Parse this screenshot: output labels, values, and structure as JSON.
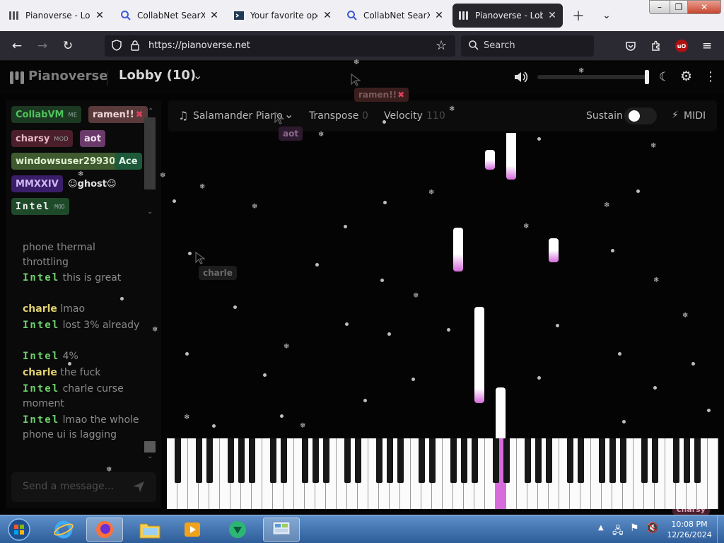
{
  "browser": {
    "tabs": [
      {
        "title": "Pianoverse - Lobby",
        "icon": "pianoverse-icon"
      },
      {
        "title": "CollabNet SearXNG",
        "icon": "search-icon"
      },
      {
        "title": "Your favorite opera",
        "icon": "terminal-icon"
      },
      {
        "title": "CollabNet SearXNG",
        "icon": "search-icon"
      },
      {
        "title": "Pianoverse - Lobby",
        "icon": "pianoverse-icon"
      }
    ],
    "active_tab": 4,
    "url": "https://pianoverse.net",
    "search_placeholder": "Search",
    "ext_badge": "uO"
  },
  "app": {
    "brand": "Pianoverse",
    "room": "Lobby (10)",
    "accent": "#d66bdc"
  },
  "users": [
    {
      "name": "CollabVM",
      "tag": "ME",
      "color": "#2d8a3e",
      "bg": "#1c3a22"
    },
    {
      "name": "ramen!!",
      "tag": "",
      "icon": "close-icon",
      "color": "#f0d0d0",
      "bg": "#5a3a3a"
    },
    {
      "name": "charsy",
      "tag": "MOD",
      "color": "#e0b0c0",
      "bg": "#4a1e2a"
    },
    {
      "name": "aot",
      "tag": "",
      "color": "#f0e0f0",
      "bg": "#6a3a6a"
    },
    {
      "name": "windowsuser29930",
      "tag": "",
      "color": "#d0f0d0",
      "bg": "#3e5a2e"
    },
    {
      "name": "Ace",
      "tag": "",
      "color": "#d0f0e0",
      "bg": "#1e5a3a"
    },
    {
      "name": "MMXXIV",
      "tag": "",
      "color": "#d0b0f0",
      "bg": "#3a1e6a"
    },
    {
      "name": "ghost",
      "tag": "",
      "color": "#e0e0e0",
      "bg": "#0a0a0a"
    },
    {
      "name": "Intel",
      "tag": "MOD",
      "color": "#f0f0f0",
      "bg": "#1e4a2a"
    }
  ],
  "messages": [
    {
      "user": "",
      "text": "phone thermal throttling"
    },
    {
      "user": "Intel",
      "text": "this is great"
    },
    {
      "user": "charle",
      "text": "lmao"
    },
    {
      "user": "Intel",
      "text": "lost 3% already"
    },
    {
      "user": "Intel",
      "text": "4%"
    },
    {
      "user": "charle",
      "text": "the fuck"
    },
    {
      "user": "Intel",
      "text": "charle curse moment"
    },
    {
      "user": "Intel",
      "text": "lmao the whole phone ui is lagging"
    }
  ],
  "chat_placeholder": "Send a message...",
  "toolbar": {
    "instrument": "Salamander Piano",
    "transpose_label": "Transpose",
    "transpose_value": "0",
    "velocity_label": "Velocity",
    "velocity_value": "110",
    "sustain_label": "Sustain",
    "midi_label": "MIDI"
  },
  "cursors": [
    {
      "name": "ramen!!"
    },
    {
      "name": "aot"
    },
    {
      "name": "charle"
    },
    {
      "name": "charsy"
    }
  ],
  "volume": 1.0,
  "taskbar": {
    "time": "10:08 PM",
    "date": "12/26/2024"
  }
}
